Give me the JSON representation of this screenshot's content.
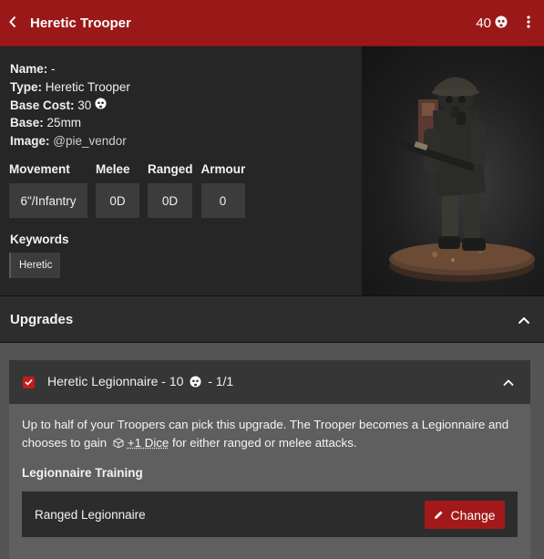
{
  "header": {
    "title": "Heretic Trooper",
    "cost": "40",
    "back_icon": "chevron-left-icon",
    "menu_icon": "kebab-menu-icon",
    "cost_icon": "skull-icon"
  },
  "info": {
    "name_label": "Name:",
    "name_value": "-",
    "type_label": "Type:",
    "type_value": "Heretic Trooper",
    "base_cost_label": "Base Cost:",
    "base_cost_value": "30",
    "base_label": "Base:",
    "base_value": "25mm",
    "image_label": "Image:",
    "image_value": "@pie_vendor"
  },
  "stats": [
    {
      "label": "Movement",
      "value": "6\"/Infantry"
    },
    {
      "label": "Melee",
      "value": "0D"
    },
    {
      "label": "Ranged",
      "value": "0D"
    },
    {
      "label": "Armour",
      "value": "0"
    }
  ],
  "keywords": {
    "title": "Keywords",
    "items": [
      "Heretic"
    ]
  },
  "upgrades": {
    "title": "Upgrades",
    "card": {
      "checked": true,
      "title_part1": "Heretic Legionnaire - 10",
      "title_part2": "- 1/1",
      "desc_part1": "Up to half of your Troopers can pick this upgrade. The Trooper becomes a Legionnaire and chooses to gain",
      "dice_text": "+1 Dice",
      "desc_part2": "for either ranged or melee attacks.",
      "training_title": "Legionnaire Training",
      "option_label": "Ranged Legionnaire",
      "change_label": "Change"
    }
  },
  "colors": {
    "header_bg": "#9b1818",
    "accent": "#a31919",
    "panel_bg": "#262626"
  }
}
